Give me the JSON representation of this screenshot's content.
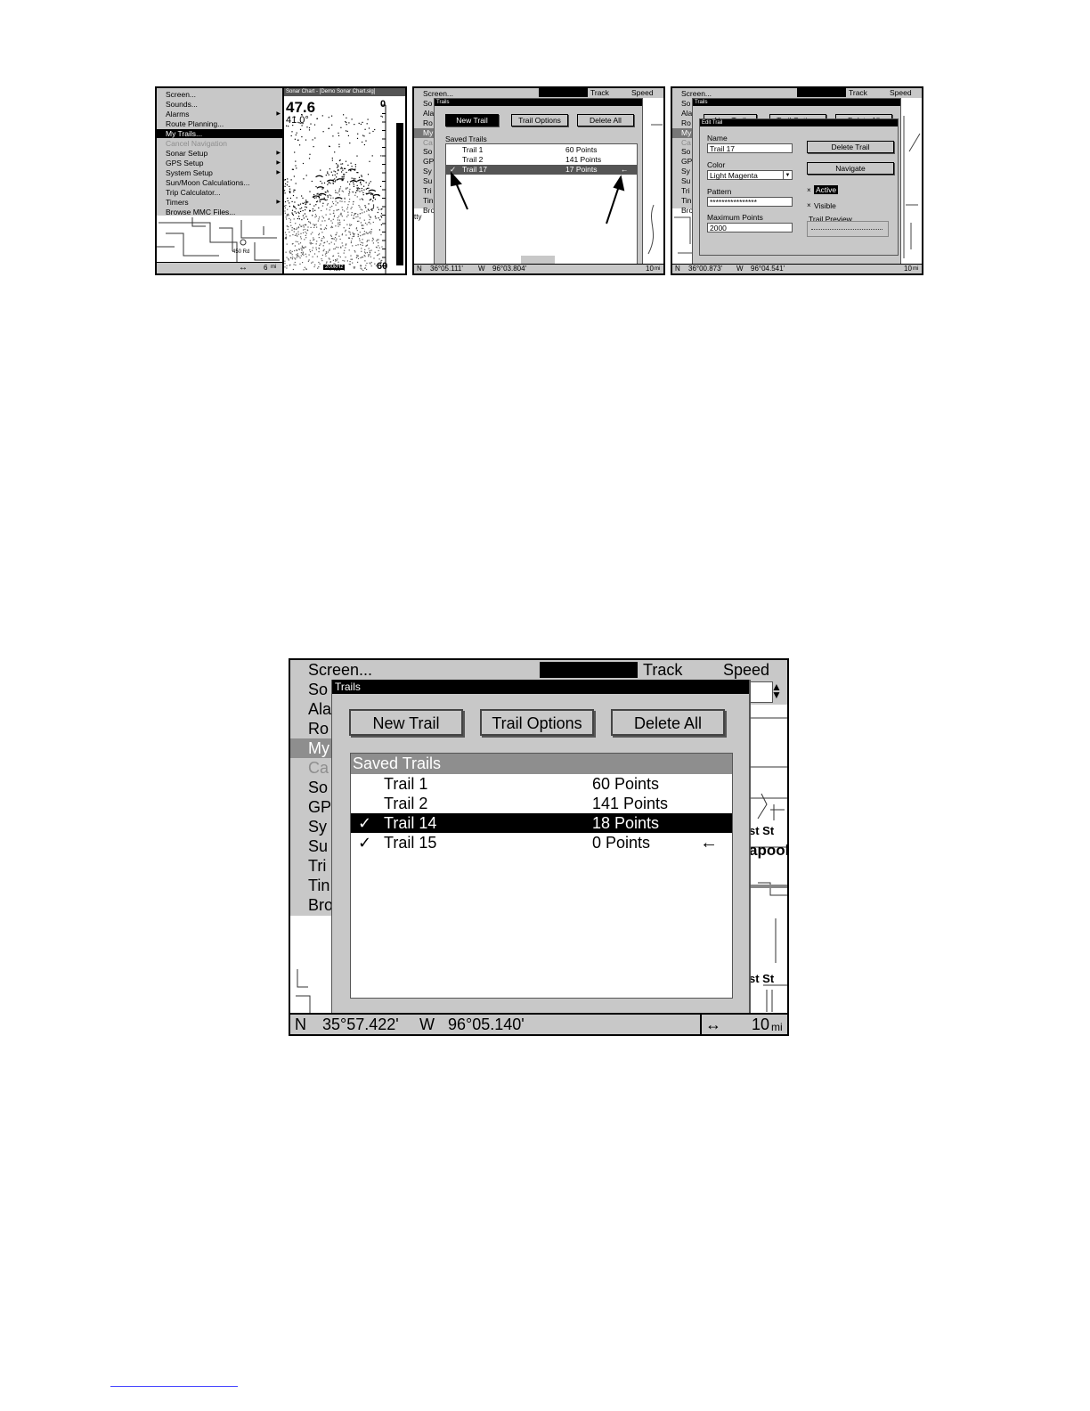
{
  "screen1": {
    "menu_items": [
      {
        "label": "Screen..."
      },
      {
        "label": "Sounds..."
      },
      {
        "label": "Alarms",
        "arrow": true
      },
      {
        "label": "Route Planning..."
      },
      {
        "label": "My Trails...",
        "selected": true
      },
      {
        "label": "Cancel Navigation",
        "disabled": true
      },
      {
        "label": "Sonar Setup",
        "arrow": true
      },
      {
        "label": "GPS Setup",
        "arrow": true
      },
      {
        "label": "System Setup",
        "arrow": true
      },
      {
        "label": "Sun/Moon Calculations..."
      },
      {
        "label": "Trip Calculator..."
      },
      {
        "label": "Timers",
        "arrow": true
      },
      {
        "label": "Browse MMC Files..."
      }
    ],
    "sonar_header": "Sonar Chart - [Demo Sonar Chart.slg]",
    "depth": "47.6",
    "temp": "41.0°",
    "scale_top": "0",
    "scale_bottom": "60",
    "scale_unit": "20",
    "mid_marks": [
      "20",
      "40"
    ],
    "frequency": "200kHz",
    "map_label": "450 Rd",
    "zoom": "6",
    "zoom_unit": "mi",
    "arrow_glyph": "↔"
  },
  "screen2": {
    "menu_partial": [
      "Screen...",
      "So",
      "Ala",
      "Ro",
      "My",
      "Ca",
      "So",
      "GP",
      "Sy",
      "Su",
      "Tri",
      "Tin",
      "Bro"
    ],
    "top_labels": {
      "track": "Track",
      "speed": "Speed"
    },
    "dialog_title": "Trails",
    "buttons": {
      "new": "New Trail",
      "options": "Trail Options",
      "delete": "Delete All"
    },
    "list_header": "Saved Trails",
    "rows": [
      {
        "check": "",
        "name": "Trail 1",
        "points": "60 Points"
      },
      {
        "check": "",
        "name": "Trail 2",
        "points": "141 Points"
      },
      {
        "check": "✓",
        "name": "Trail 17",
        "points": "17 Points",
        "selected": true
      }
    ],
    "arrow_glyph": "←",
    "status": {
      "n": "N",
      "lat": "36°05.111'",
      "w": "W",
      "lon": "96°03.804'",
      "zoom": "10",
      "unit": "mi"
    },
    "map_label": "tty"
  },
  "screen3": {
    "menu_partial": [
      "Screen...",
      "So",
      "Ala",
      "Ro",
      "My",
      "Ca",
      "So",
      "GP",
      "Sy",
      "Su",
      "Tri",
      "Tin",
      "Bro"
    ],
    "top_labels": {
      "track": "Track",
      "speed": "Speed"
    },
    "trails_title": "Trails",
    "behind_buttons": {
      "new": "New Trail",
      "options": "Trail Options",
      "delete": "Delete All"
    },
    "edit_title": "Edit Trail",
    "name_label": "Name",
    "name_value": "Trail 17",
    "color_label": "Color",
    "color_value": "Light Magenta",
    "pattern_label": "Pattern",
    "pattern_value": "****************",
    "max_label": "Maximum Points",
    "max_value": "2000",
    "delete_btn": "Delete Trail",
    "navigate_btn": "Navigate",
    "active_label": "Active",
    "visible_label": "Visible",
    "preview_label": "Trail Preview",
    "check_glyph": "×",
    "status": {
      "n": "N",
      "lat": "36°00.873'",
      "w": "W",
      "lon": "96°04.541'",
      "zoom": "10",
      "unit": "mi"
    }
  },
  "big": {
    "top_labels": {
      "screen": "Screen...",
      "track": "Track",
      "speed": "Speed"
    },
    "menu_partial": [
      "So",
      "Ala",
      "Ro",
      "My",
      "Ca",
      "So",
      "GP",
      "Sy",
      "Su",
      "Tri",
      "Tin",
      "Bro"
    ],
    "dialog_title": "Trails",
    "buttons": {
      "new": "New Trail",
      "options": "Trail Options",
      "delete": "Delete All"
    },
    "list_header": "Saved Trails",
    "rows": [
      {
        "check": "",
        "name": "Trail 1",
        "points": "60 Points"
      },
      {
        "check": "",
        "name": "Trail 2",
        "points": "141 Points"
      },
      {
        "check": "✓",
        "name": "Trail 14",
        "points": "18 Points",
        "selected": true
      },
      {
        "check": "✓",
        "name": "Trail 15",
        "points": "0 Points"
      }
    ],
    "arrow_glyph": "←",
    "map_labels": {
      "street1": "st St",
      "town": "apool",
      "street2": "st St"
    },
    "status": {
      "n": "N",
      "lat": "35°57.422'",
      "w": "W",
      "lon": "96°05.140'",
      "arrows": "↔",
      "zoom": "10",
      "unit": "mi"
    }
  }
}
